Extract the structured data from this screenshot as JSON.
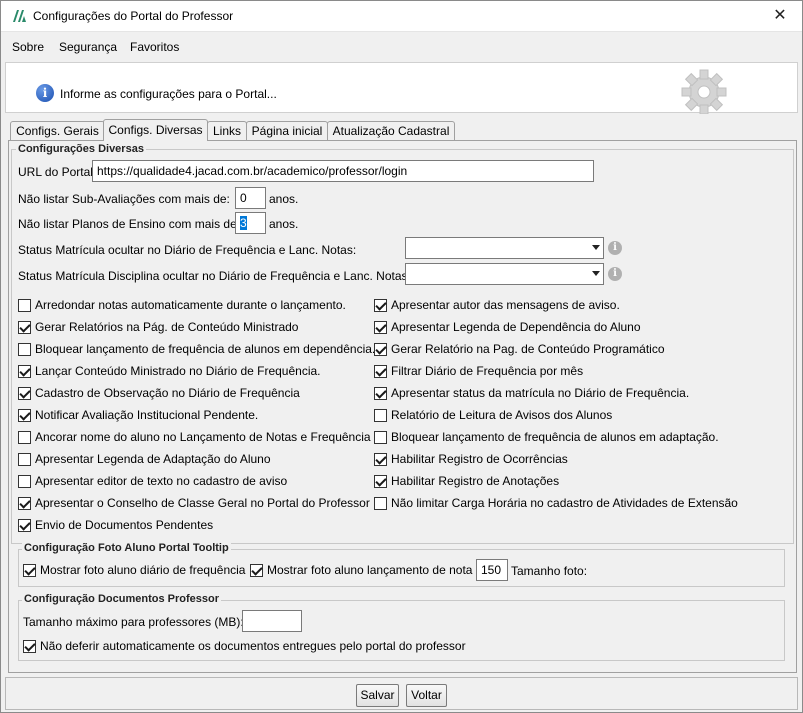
{
  "window": {
    "title": "Configurações do Portal do Professor",
    "close_glyph": "✕",
    "logo_icon": "app-logo-icon"
  },
  "menu": {
    "items": [
      "Sobre",
      "Segurança",
      "Favoritos"
    ]
  },
  "info": {
    "text": "Informe as configurações para o Portal...",
    "info_glyph": "i"
  },
  "tabs": [
    "Configs. Gerais",
    "Configs. Diversas",
    "Links",
    "Página inicial",
    "Atualização Cadastral"
  ],
  "active_tab": "Configs. Diversas",
  "diversas": {
    "legend": "Configurações Diversas",
    "url_label": "URL do Portal:",
    "url_value": "https://qualidade4.jacad.com.br/academico/professor/login",
    "sub_label": "Não listar Sub-Avaliações com mais de:",
    "sub_value": "0",
    "sub_unit": "anos.",
    "planos_label": "Não listar Planos de Ensino com mais de:",
    "planos_value": "3",
    "planos_unit": "anos.",
    "status_matricula_label": "Status Matrícula ocultar no Diário de Frequência e Lanc. Notas:",
    "status_matricula_value": "",
    "status_disciplina_label": "Status Matrícula Disciplina ocultar no Diário de Frequência e Lanc. Notas:",
    "status_disciplina_value": "",
    "hint_glyph": "i"
  },
  "checkboxes_left": [
    {
      "label": "Arredondar notas automaticamente durante o lançamento.",
      "checked": false
    },
    {
      "label": "Gerar Relatórios na Pág. de Conteúdo Ministrado",
      "checked": true
    },
    {
      "label": "Bloquear lançamento de frequência de alunos em dependência.",
      "checked": false
    },
    {
      "label": "Lançar Conteúdo Ministrado no Diário de Frequência.",
      "checked": true
    },
    {
      "label": "Cadastro de Observação no Diário de Frequência",
      "checked": true
    },
    {
      "label": "Notificar Avaliação Institucional Pendente.",
      "checked": true
    },
    {
      "label": "Ancorar nome do aluno no Lançamento de Notas e Frequência",
      "checked": false
    },
    {
      "label": "Apresentar Legenda de Adaptação do Aluno",
      "checked": false
    },
    {
      "label": "Apresentar editor de texto no cadastro de aviso",
      "checked": false
    },
    {
      "label": "Apresentar o Conselho de Classe Geral no Portal do Professor",
      "checked": true
    },
    {
      "label": "Envio de Documentos Pendentes",
      "checked": true
    }
  ],
  "checkboxes_right": [
    {
      "label": "Apresentar autor das mensagens de aviso.",
      "checked": true
    },
    {
      "label": "Apresentar Legenda de Dependência do Aluno",
      "checked": true
    },
    {
      "label": "Gerar Relatório na Pag. de Conteúdo Programático",
      "checked": true
    },
    {
      "label": "Filtrar Diário de Frequência por mês",
      "checked": true
    },
    {
      "label": "Apresentar status da matrícula no Diário de Frequência.",
      "checked": true
    },
    {
      "label": "Relatório de Leitura de Avisos dos Alunos",
      "checked": false
    },
    {
      "label": "Bloquear lançamento de frequência de alunos em adaptação.",
      "checked": false
    },
    {
      "label": "Habilitar Registro de Ocorrências",
      "checked": true
    },
    {
      "label": "Habilitar Registro de Anotações",
      "checked": true
    },
    {
      "label": "Não limitar Carga Horária no cadastro de Atividades de Extensão",
      "checked": false
    }
  ],
  "foto": {
    "legend": "Configuração Foto Aluno Portal Tooltip",
    "diario_label": "Mostrar foto aluno diário de frequência",
    "diario_checked": true,
    "nota_label": "Mostrar foto aluno lançamento de nota",
    "nota_checked": true,
    "tamanho_value": "150",
    "tamanho_label": "Tamanho foto:"
  },
  "documentos": {
    "legend": "Configuração Documentos Professor",
    "tamanho_label": "Tamanho máximo para professores (MB):",
    "tamanho_value": "",
    "nao_deferir_label": "Não deferir automaticamente os documentos entregues pelo portal do professor",
    "nao_deferir_checked": true
  },
  "buttons": {
    "salvar": "Salvar",
    "voltar": "Voltar"
  }
}
